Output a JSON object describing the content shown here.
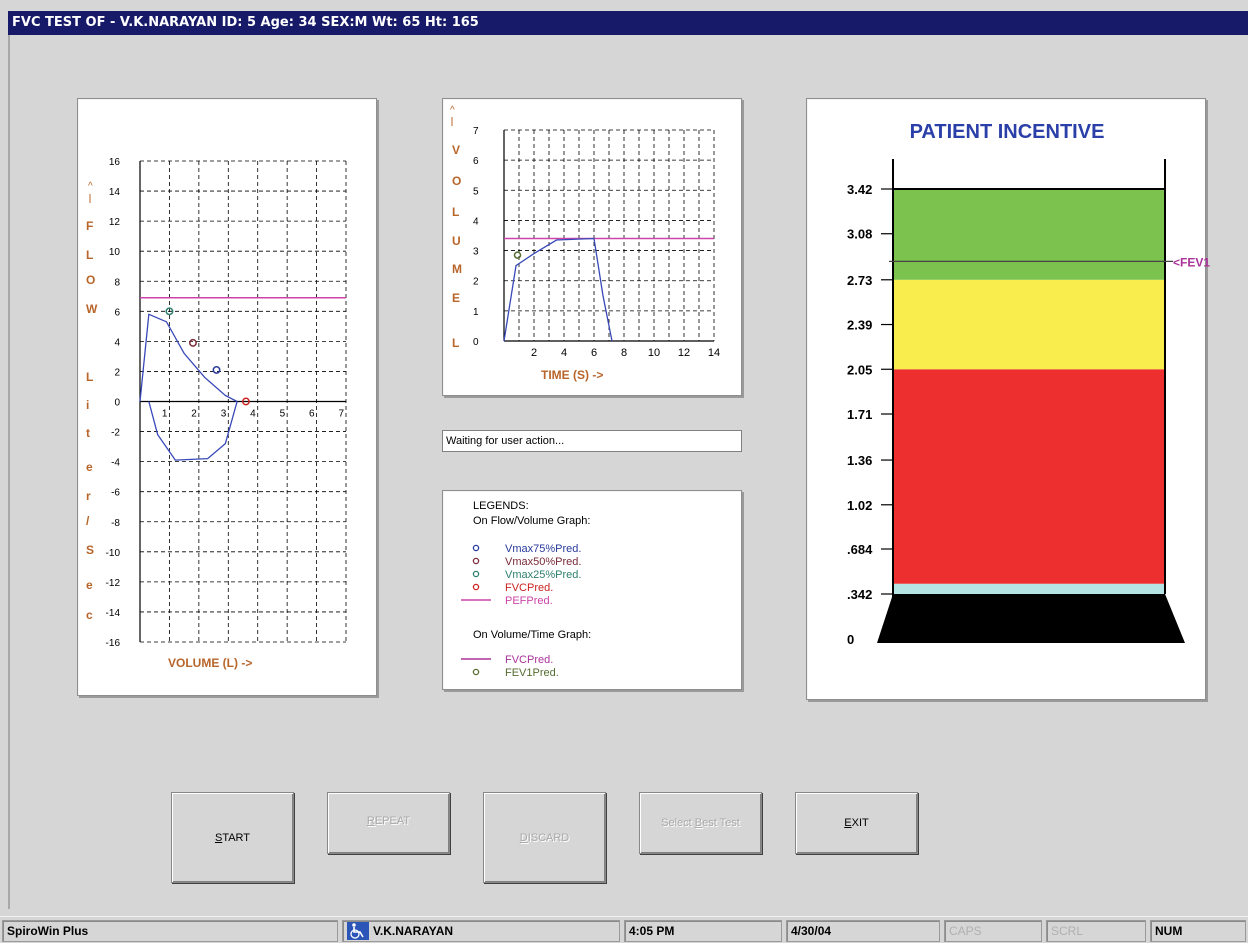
{
  "window": {
    "title": "FVC TEST OF  - V.K.NARAYAN  ID: 5  Age: 34  SEX:M   Wt: 65   Ht: 165"
  },
  "flow_volume_chart": {
    "chart_data": {
      "type": "line",
      "title": "",
      "xlabel": "VOLUME (L) ->",
      "ylabel": "^ | F L O W  L i t e r / S e c",
      "ylabel_letters": [
        "F",
        "L",
        "O",
        "W",
        "L",
        "i",
        "t",
        "e",
        "r",
        "/",
        "S",
        "e",
        "c"
      ],
      "x_ticks": [
        "1",
        "2",
        "3",
        "4",
        "5",
        "6",
        "7"
      ],
      "y_ticks": [
        "16",
        "14",
        "12",
        "10",
        "8",
        "6",
        "4",
        "2",
        "0",
        "-2",
        "-4",
        "-6",
        "-8",
        "-10",
        "-12",
        "-14",
        "-16"
      ],
      "xlim": [
        0,
        7
      ],
      "ylim": [
        -16,
        16
      ],
      "grid": true,
      "series": [
        {
          "role": "expiratory-loop",
          "x": [
            0,
            0.3,
            0.9,
            1.5,
            2.2,
            2.9,
            3.3
          ],
          "y": [
            0,
            5.8,
            5.3,
            3.2,
            1.6,
            0.4,
            0
          ]
        },
        {
          "role": "inspiratory-loop",
          "x": [
            0.3,
            0.6,
            1.2,
            2.3,
            2.9,
            3.3
          ],
          "y": [
            0,
            -2.2,
            -3.9,
            -3.8,
            -2.8,
            0
          ]
        }
      ],
      "reference_line": {
        "label": "PEFPred.",
        "y": 6.9,
        "color": "#cc44aa"
      },
      "markers": [
        {
          "label": "Vmax25%Pred.",
          "x": 1.0,
          "y": 6.0,
          "color": "#2d7f6e",
          "text": "o"
        },
        {
          "label": "Vmax50%Pred.",
          "x": 1.8,
          "y": 3.9,
          "color": "#7a2a3a",
          "text": "o"
        },
        {
          "label": "Vmax75%Pred.",
          "x": 2.6,
          "y": 2.1,
          "color": "#2a3a9a",
          "text": "o"
        },
        {
          "label": "FVCPred.",
          "x": 3.6,
          "y": 0.0,
          "color": "#cc2222",
          "text": "o"
        }
      ]
    }
  },
  "volume_time_chart": {
    "chart_data": {
      "type": "line",
      "title": "",
      "xlabel": "TIME (S) ->",
      "ylabel": "^ | V O L U M E  L",
      "ylabel_letters": [
        "V",
        "O",
        "L",
        "U",
        "M",
        "E",
        "L"
      ],
      "x_ticks": [
        "2",
        "4",
        "6",
        "8",
        "10",
        "12",
        "14"
      ],
      "y_ticks": [
        "7",
        "6",
        "5",
        "4",
        "3",
        "2",
        "1",
        "0"
      ],
      "xlim": [
        0,
        14
      ],
      "ylim": [
        0,
        7
      ],
      "grid": true,
      "series": [
        {
          "role": "volume-curve",
          "x": [
            0,
            0.8,
            2,
            3.5,
            6,
            6.6,
            7.2
          ],
          "y": [
            0,
            2.5,
            2.9,
            3.35,
            3.4,
            1.5,
            0
          ]
        }
      ],
      "reference_line": {
        "label": "FVCPred.",
        "y": 3.4,
        "color": "#cc44aa"
      },
      "markers": [
        {
          "label": "FEV1Pred.",
          "x": 0.9,
          "y": 2.85,
          "color": "#556b2f",
          "text": "o"
        }
      ]
    }
  },
  "incentive_chart": {
    "chart_data": {
      "type": "bar",
      "title": "PATIENT INCENTIVE",
      "y_ticks": [
        "3.42",
        "3.08",
        "2.73",
        "2.39",
        "2.05",
        "1.71",
        "1.36",
        "1.02",
        ".684",
        ".342",
        "0"
      ],
      "ylim": [
        0,
        3.42
      ],
      "bands": [
        {
          "from": 0,
          "to": 0.342,
          "color": "#000000"
        },
        {
          "from": 0.342,
          "to": 0.42,
          "color": "#b6e3e3"
        },
        {
          "from": 0.42,
          "to": 2.05,
          "color": "#ee2f2f"
        },
        {
          "from": 2.05,
          "to": 2.73,
          "color": "#f9ed4e"
        },
        {
          "from": 2.73,
          "to": 3.42,
          "color": "#7bc24f"
        }
      ],
      "marker": {
        "label": "<FEV1",
        "value": 2.87,
        "color": "#aa3399"
      }
    }
  },
  "status_message": "Waiting for user action...",
  "legends": {
    "heading": "LEGENDS:",
    "flow_volume_heading": "On Flow/Volume Graph:",
    "volume_time_heading": "On Volume/Time Graph:",
    "flow_volume_items": [
      {
        "symbol": "o",
        "label": "Vmax75%Pred.",
        "color": "#2a3a9a"
      },
      {
        "symbol": "o",
        "label": "Vmax50%Pred.",
        "color": "#7a2a3a"
      },
      {
        "symbol": "o",
        "label": "Vmax25%Pred.",
        "color": "#2d7f6e"
      },
      {
        "symbol": "o",
        "label": "FVCPred.",
        "color": "#cc2222"
      },
      {
        "symbol": "line",
        "label": "PEFPred.",
        "color": "#cc44aa"
      }
    ],
    "volume_time_items": [
      {
        "symbol": "line",
        "label": "FVCPred.",
        "color": "#aa3399"
      },
      {
        "symbol": "o",
        "label": "FEV1Pred.",
        "color": "#556b2f"
      }
    ]
  },
  "buttons": {
    "start": {
      "label": "START",
      "mnemonic": "S",
      "rest": "TART",
      "enabled": true
    },
    "repeat": {
      "label": "REPEAT",
      "mnemonic": "R",
      "rest": "EPEAT",
      "enabled": false
    },
    "discard": {
      "label": "DISCARD",
      "mnemonic": "D",
      "rest": "ISCARD",
      "enabled": false
    },
    "select_best": {
      "label": "Select Best Test",
      "pre": "Select ",
      "mnemonic": "B",
      "rest": "est Test",
      "enabled": false
    },
    "exit": {
      "label": "EXIT",
      "mnemonic": "E",
      "rest": "XIT",
      "enabled": true
    }
  },
  "statusbar": {
    "app_name": "SpiroWin Plus",
    "patient": "V.K.NARAYAN",
    "time": "4:05 PM",
    "date": "4/30/04",
    "caps": "CAPS",
    "scrl": "SCRL",
    "num": "NUM"
  },
  "colors": {
    "title_bg": "#171a68",
    "axis_label": "#b8652a",
    "incentive_title": "#2b3fa8",
    "curve": "#3848b8"
  }
}
